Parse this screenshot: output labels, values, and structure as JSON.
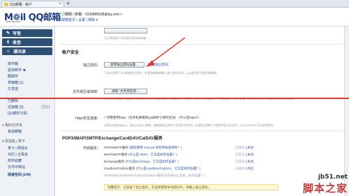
{
  "browser": {
    "tab_title": "QQ邮箱 - 帐户",
    "tab_close": "×",
    "new_tab": "+"
  },
  "logo": {
    "text": "M❁il QQ邮箱",
    "sub": "mail.qq.com"
  },
  "header": {
    "account": "◎碳碳 / 账箱 - 1039685538@qq.com >",
    "links": "邮箱首页 | 设置 | 换肤 ▾"
  },
  "sidebar": {
    "write": "写信",
    "inbox": "收信",
    "contacts": "通讯录",
    "items": [
      {
        "label": "收件箱",
        "count": ""
      },
      {
        "label": "星标邮件 ★",
        "count": ""
      },
      {
        "label": "群邮件",
        "count": ""
      },
      {
        "label": "草稿箱 (1)",
        "count": ""
      },
      {
        "label": "已发送",
        "count": ""
      },
      {
        "label": "已删除",
        "count": ""
      },
      {
        "label": "垃圾箱 (3)",
        "count": "[清空]"
      },
      {
        "label": "QQ邮件订阅",
        "count": ""
      }
    ],
    "folder_header": "▾ 我的文件夹",
    "folder_item": "其他邮箱",
    "apps_header": "▾ 漂流瓶 | 贺卡",
    "apps": [
      "贺卡 | 明信片",
      "日历 | 记事本",
      "附件收藏",
      "文件中转站",
      "阅读空间 (144)"
    ]
  },
  "top_block": {
    "hint": "可以将此账户的内容迁移到本邮箱",
    "button": ""
  },
  "security": {
    "title": "帐户安全",
    "pwd_label": "独立密码：",
    "pwd_button": "更改独立密码设置...",
    "pwd_link": "[管理独立密码]",
    "pwd_hint": "已启动设置了QQ邮箱独立密码，在登录邮箱需输入独立密码验证，QQ密码将不能登录邮箱。",
    "folder_label": "文件夹区域加锁：",
    "folder_button": "加锁 \"文件夹区域\"...",
    "folder_hint": "给 \"文件夹区域\" 加锁后，\"我的文件夹\"、\"其他邮箱\"、\"记事本\"、\"日历\"、\"贺卡\"、\"明信片\"、\"手机邮箱\"、\"附件收藏\" 等模块会在访问时要求输入独立密码。",
    "https_label": "https安全连接：",
    "https_check": "□ 完整使用https（仅手机邮箱和QQ邮件订阅时生效）（什么是https?）",
    "https_hint": "设置全程使用https，会在QQ进入邮箱，搜集数据后将处于受保护状态的，在使用支撑的下载管中提示安全性，QQ2005年才可以选择使用。"
  },
  "services": {
    "title": "POP3/IMAP/SMTP/Exchange/CardDAV/CalDAV服务",
    "label": "开启服务：",
    "rows": [
      {
        "name": "POP3/SMTP服务",
        "link": "(如何使用 Foxmail 等软件收发邮件？)",
        "state": "已开启",
        "action": "关闭"
      },
      {
        "name": "IMAP/SMTP服务",
        "link": "(什么是 IMAP，它又是如何设置？)",
        "state": "已开启",
        "action": "关闭"
      },
      {
        "name": "Exchange服务",
        "link": "(什么是Exchange，它又是如何设置？)",
        "state": "已开启",
        "action": "关闭"
      },
      {
        "name": "CardDAV/CalDAV服务",
        "link": "(什么是CardDAV/CalDAV，它又是如何设置？)",
        "state": "已关闭",
        "action": "开启"
      }
    ],
    "extra": "(POP3/IMAP/SMTP/CardDAV/CalDAV服务均支持SSL连接，如何设置？)",
    "notice": "温馨提示：已登录了独立密码，在选择使用本地密码时，请输入独立密码。"
  },
  "watermark": {
    "line1": "jb51.net",
    "line2": "脚本之家"
  },
  "colors": {
    "sidebar_btn": "#2e4f74",
    "link": "#2353a8",
    "annotation_red": "#e4382f"
  }
}
